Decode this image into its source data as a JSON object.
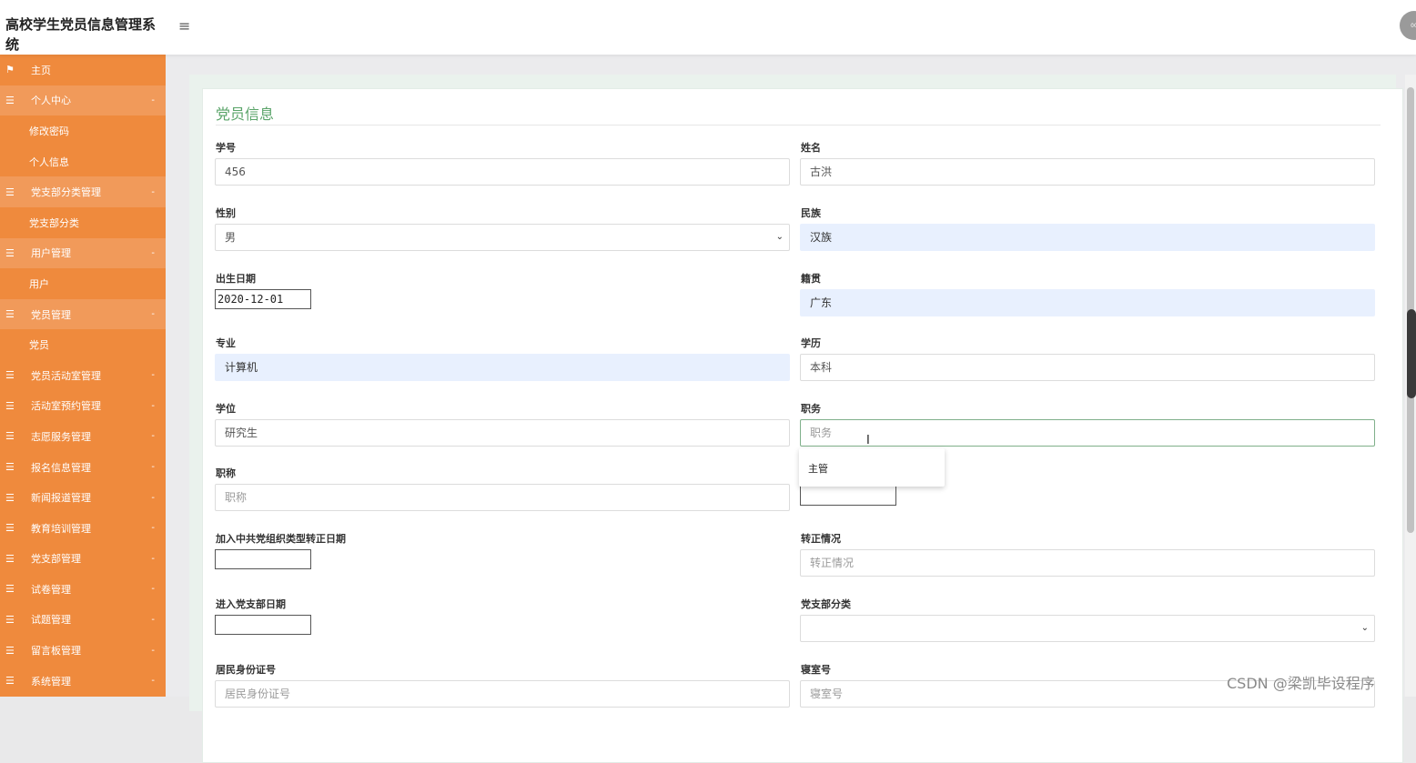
{
  "app": {
    "title": "高校学生党员信息管理系统",
    "avatar_text": "00"
  },
  "sidebar": {
    "items": [
      {
        "label": "主页",
        "kind": "link",
        "icon": "flag-icon",
        "glyph": "⚑"
      },
      {
        "label": "个人中心",
        "kind": "group",
        "icon": "menu-icon",
        "glyph": "☰",
        "chev": "-"
      },
      {
        "label": "修改密码",
        "kind": "sub"
      },
      {
        "label": "个人信息",
        "kind": "sub"
      },
      {
        "label": "党支部分类管理",
        "kind": "group",
        "icon": "menu-icon",
        "glyph": "☰",
        "chev": "-"
      },
      {
        "label": "党支部分类",
        "kind": "sub"
      },
      {
        "label": "用户管理",
        "kind": "group",
        "icon": "menu-icon",
        "glyph": "☰",
        "chev": "-"
      },
      {
        "label": "用户",
        "kind": "sub"
      },
      {
        "label": "党员管理",
        "kind": "group",
        "icon": "menu-icon",
        "glyph": "☰",
        "chev": "-"
      },
      {
        "label": "党员",
        "kind": "sub"
      },
      {
        "label": "党员活动室管理",
        "kind": "collapsed",
        "icon": "menu-icon",
        "glyph": "☰",
        "chev": "-"
      },
      {
        "label": "活动室预约管理",
        "kind": "collapsed",
        "icon": "menu-icon",
        "glyph": "☰",
        "chev": "-"
      },
      {
        "label": "志愿服务管理",
        "kind": "collapsed",
        "icon": "menu-icon",
        "glyph": "☰",
        "chev": "-"
      },
      {
        "label": "报名信息管理",
        "kind": "collapsed",
        "icon": "menu-icon",
        "glyph": "☰",
        "chev": "-"
      },
      {
        "label": "新闻报道管理",
        "kind": "collapsed",
        "icon": "menu-icon",
        "glyph": "☰",
        "chev": "-"
      },
      {
        "label": "教育培训管理",
        "kind": "collapsed",
        "icon": "menu-icon",
        "glyph": "☰",
        "chev": "-"
      },
      {
        "label": "党支部管理",
        "kind": "collapsed",
        "icon": "menu-icon",
        "glyph": "☰",
        "chev": "-"
      },
      {
        "label": "试卷管理",
        "kind": "collapsed",
        "icon": "menu-icon",
        "glyph": "☰",
        "chev": "-"
      },
      {
        "label": "试题管理",
        "kind": "collapsed",
        "icon": "menu-icon",
        "glyph": "☰",
        "chev": "-"
      },
      {
        "label": "留言板管理",
        "kind": "collapsed",
        "icon": "menu-icon",
        "glyph": "☰",
        "chev": "-"
      },
      {
        "label": "系统管理",
        "kind": "collapsed",
        "icon": "menu-icon",
        "glyph": "☰",
        "chev": "-"
      }
    ]
  },
  "form": {
    "title": "党员信息",
    "student_no": {
      "label": "学号",
      "value": "456"
    },
    "name": {
      "label": "姓名",
      "value": "古洪"
    },
    "gender": {
      "label": "性别",
      "value": "男"
    },
    "ethnicity": {
      "label": "民族",
      "value": "汉族"
    },
    "birth_date": {
      "label": "出生日期",
      "value": "2020-12-01"
    },
    "native_place": {
      "label": "籍贯",
      "value": "广东"
    },
    "major": {
      "label": "专业",
      "value": "计算机"
    },
    "education": {
      "label": "学历",
      "value": "本科"
    },
    "degree": {
      "label": "学位",
      "value": "研究生"
    },
    "position": {
      "label": "职务",
      "placeholder": "职务"
    },
    "position_suggestion": "主管",
    "title_field": {
      "label": "职称",
      "placeholder": "职称"
    },
    "join_date": {
      "label": "加入中共党组织类型转正日期"
    },
    "regularization": {
      "label": "转正情况",
      "placeholder": "转正情况"
    },
    "branch_date": {
      "label": "进入党支部日期"
    },
    "branch_category": {
      "label": "党支部分类",
      "value": ""
    },
    "id_card": {
      "label": "居民身份证号",
      "placeholder": "居民身份证号"
    },
    "dorm": {
      "label": "寝室号",
      "placeholder": "寝室号"
    }
  },
  "watermark": "CSDN @梁凯毕设程序",
  "colors": {
    "sidebar": "#ef8a3d",
    "accent": "#5aa469",
    "autofill": "#e8f0fe"
  }
}
